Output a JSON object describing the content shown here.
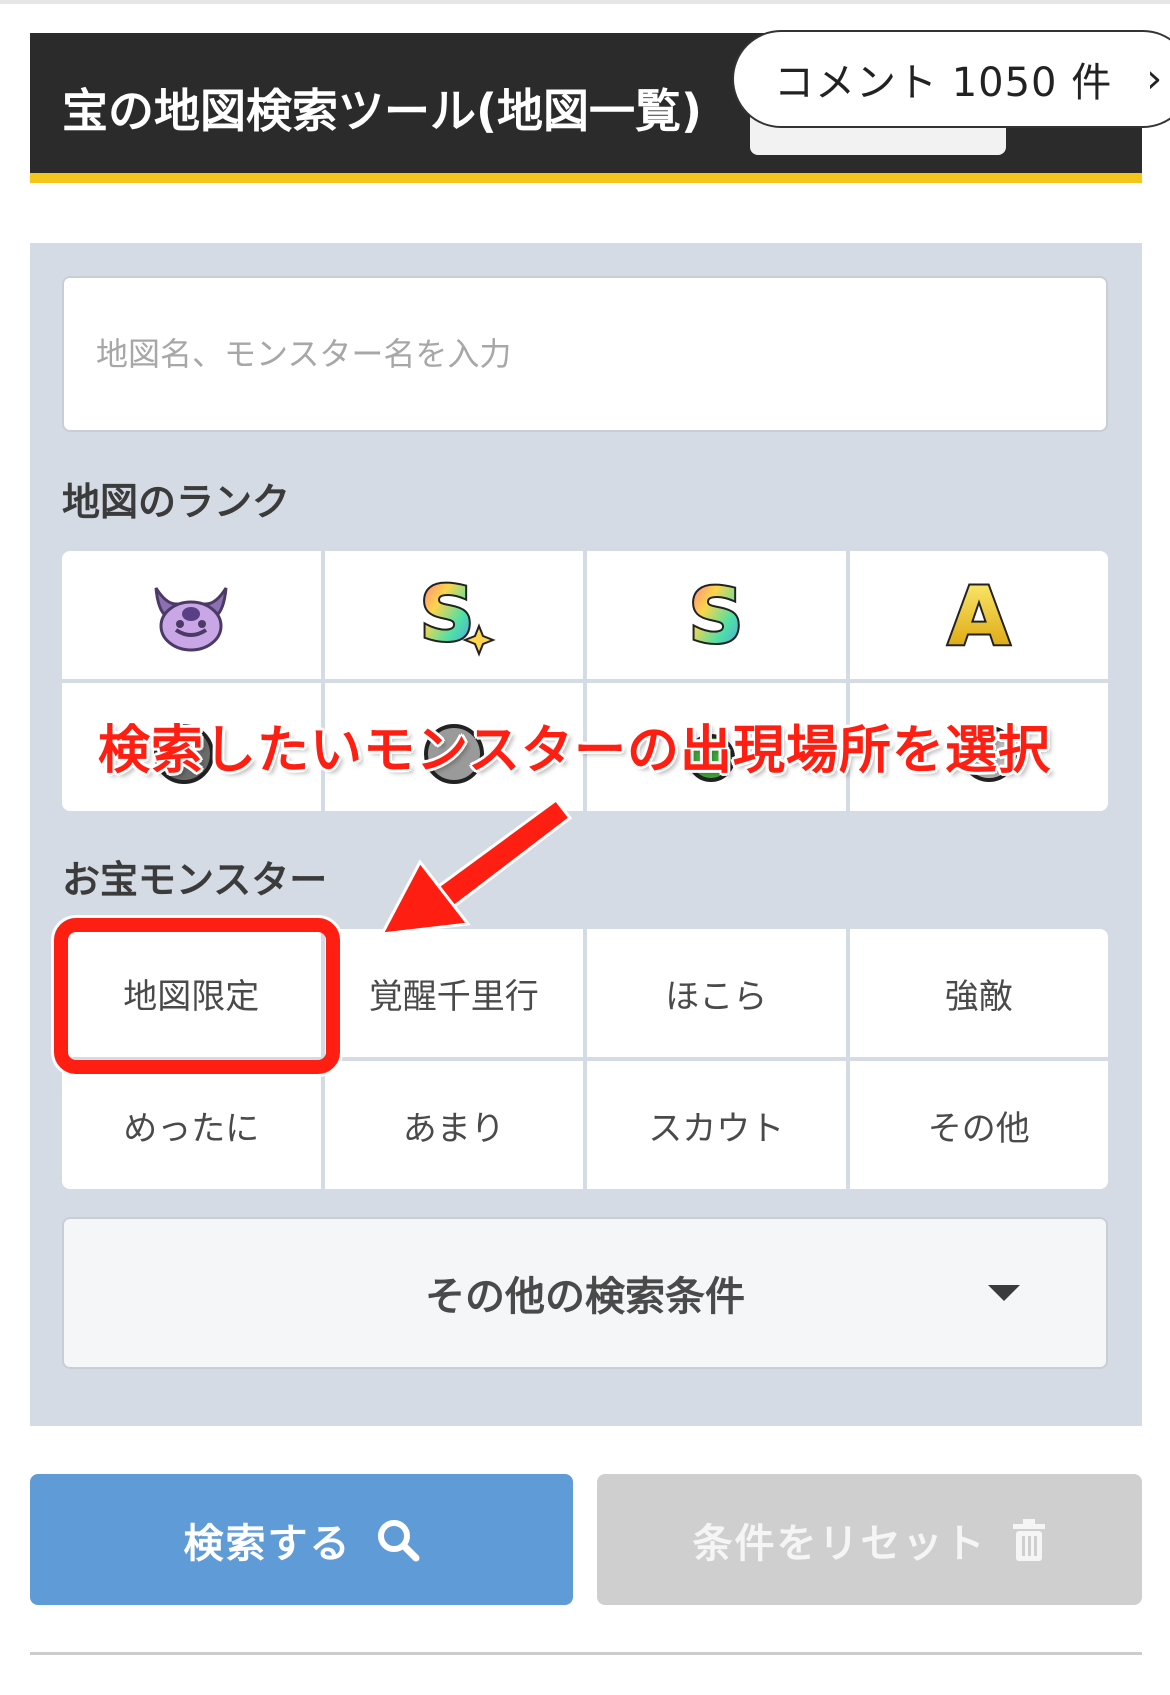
{
  "header": {
    "title": "宝の地図検索ツール(地図一覧)",
    "comment_label": "コメント 1050 件",
    "comment_chevron": "›"
  },
  "search": {
    "placeholder": "地図名、モンスター名を入力"
  },
  "rank_section": {
    "heading": "地図のランク",
    "items": [
      {
        "icon": "demon-king-rank-icon",
        "label": ""
      },
      {
        "icon": "s-sparkle-rank-icon",
        "label": "S"
      },
      {
        "icon": "s-rank-icon",
        "label": "S"
      },
      {
        "icon": "a-rank-icon",
        "label": "A"
      },
      {
        "icon": "b-rank-icon",
        "label": ""
      },
      {
        "icon": "c-rank-icon",
        "label": ""
      },
      {
        "icon": "d-rank-icon",
        "label": ""
      },
      {
        "icon": "e-rank-icon",
        "label": ""
      }
    ]
  },
  "monster_section": {
    "heading": "お宝モンスター",
    "items": [
      "地図限定",
      "覚醒千里行",
      "ほこら",
      "強敵",
      "めったに",
      "あまり",
      "スカウト",
      "その他"
    ]
  },
  "more_conditions": {
    "label": "その他の検索条件"
  },
  "buttons": {
    "search_label": "検索する",
    "reset_label": "条件をリセット"
  },
  "annotation": {
    "text": "検索したいモンスターの出現場所を選択",
    "color": "#ff1e12"
  },
  "colors": {
    "header_bg": "#2b2b2b",
    "header_accent": "#f4c51b",
    "panel_bg": "#d5dbe4",
    "search_button": "#5f9bd6",
    "reset_button": "#cfcfcf"
  }
}
